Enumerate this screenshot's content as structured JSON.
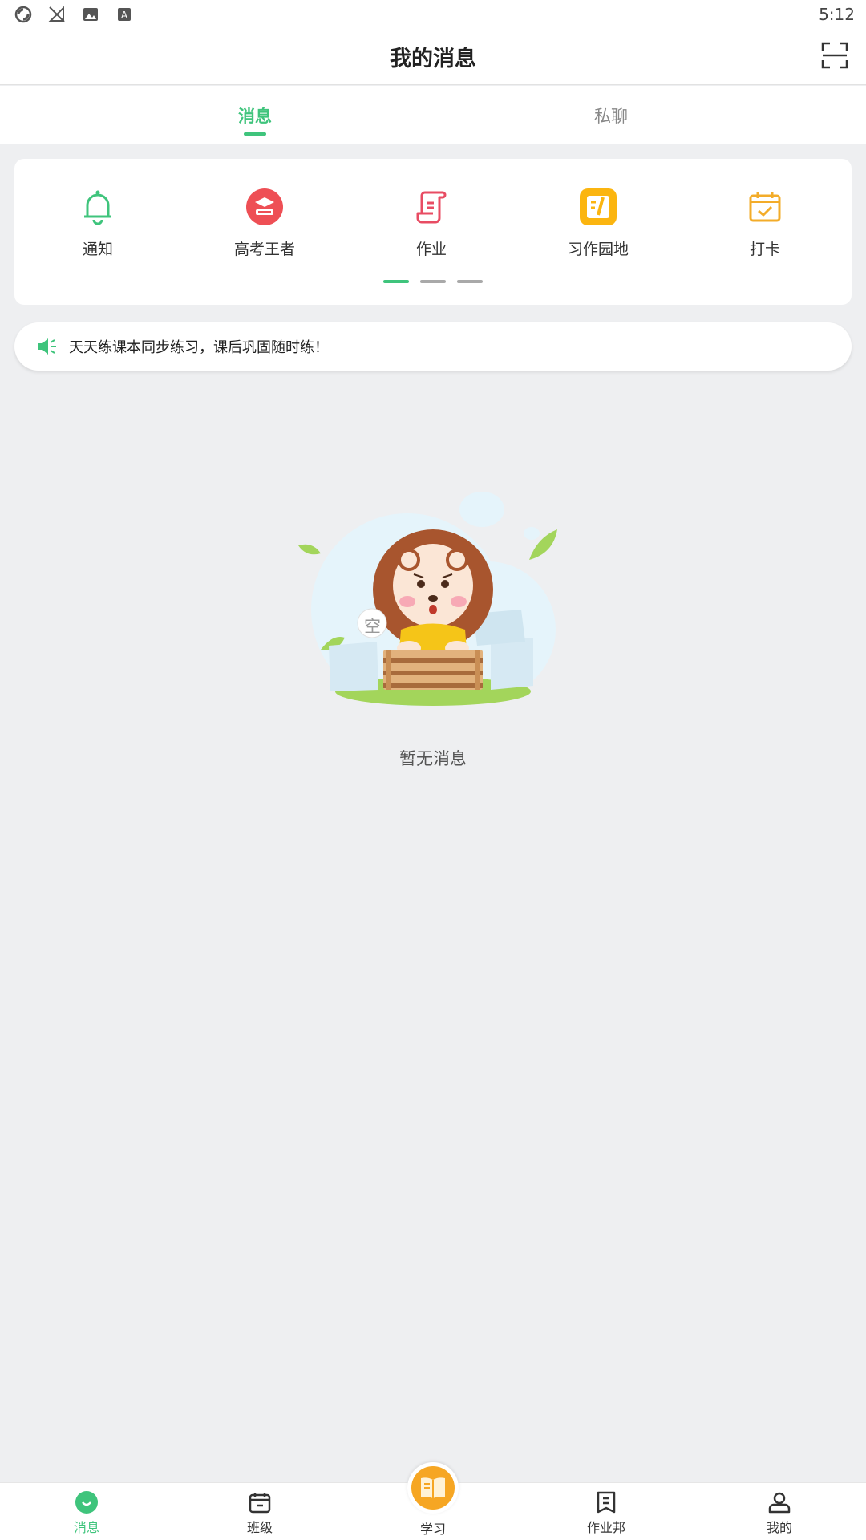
{
  "status_bar": {
    "time": "5:12"
  },
  "header": {
    "title": "我的消息"
  },
  "tabs": [
    {
      "label": "消息",
      "active": true
    },
    {
      "label": "私聊",
      "active": false
    }
  ],
  "entries": [
    {
      "label": "通知",
      "icon": "bell-icon"
    },
    {
      "label": "高考王者",
      "icon": "graduation-cap-icon"
    },
    {
      "label": "作业",
      "icon": "homework-icon"
    },
    {
      "label": "习作园地",
      "icon": "composition-icon"
    },
    {
      "label": "打卡",
      "icon": "calendar-check-icon"
    }
  ],
  "pager": {
    "pages": 3,
    "current": 1
  },
  "notice": {
    "text": "天天练课本同步练习，课后巩固随时练！"
  },
  "empty_state": {
    "badge": "空",
    "message": "暂无消息"
  },
  "bottom_nav": [
    {
      "label": "消息",
      "icon": "message-icon",
      "active": true
    },
    {
      "label": "班级",
      "icon": "class-icon",
      "active": false
    },
    {
      "label": "学习",
      "icon": "book-icon",
      "active": false
    },
    {
      "label": "作业邦",
      "icon": "homework-list-icon",
      "active": false
    },
    {
      "label": "我的",
      "icon": "profile-icon",
      "active": false
    }
  ],
  "colors": {
    "accent": "#3fc47c",
    "background": "#eeeff1",
    "study_button": "#f6a623"
  }
}
